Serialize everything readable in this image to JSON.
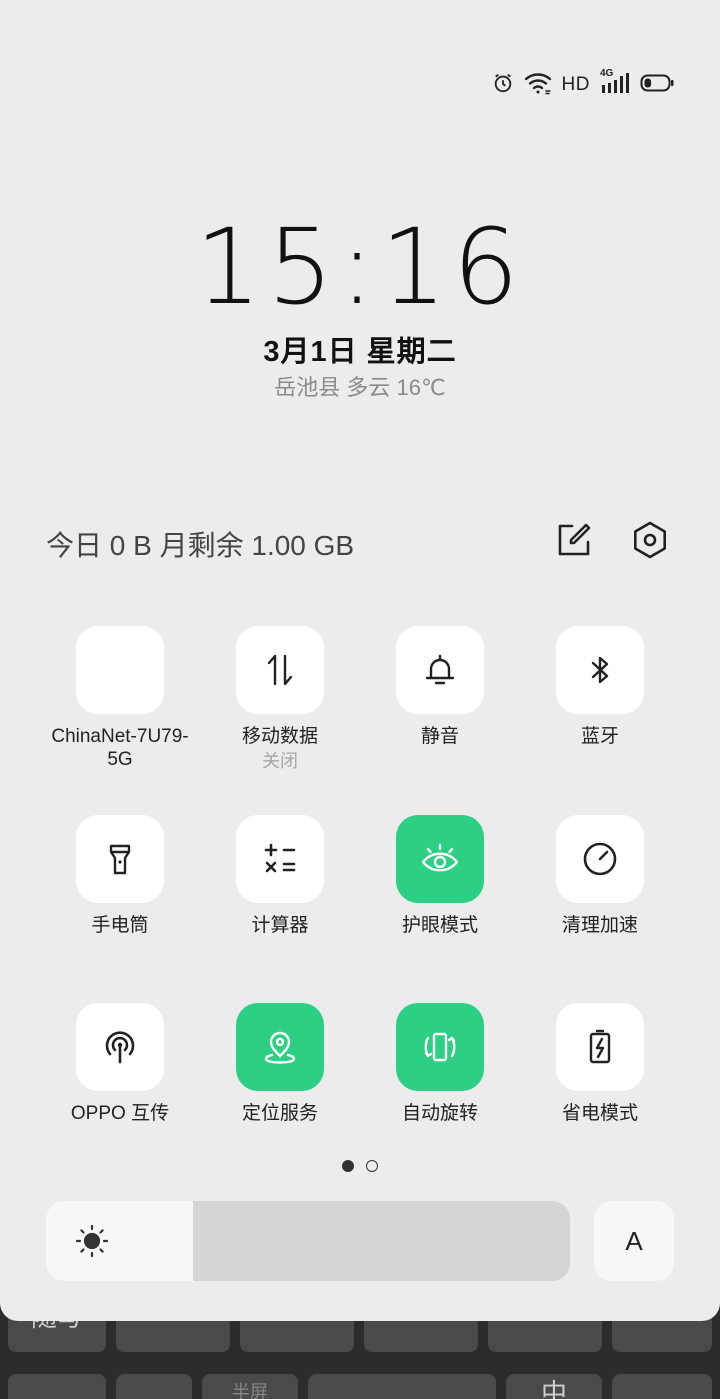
{
  "status": {
    "network_hd": "HD",
    "network_gen": "4G",
    "battery_level": 0.3
  },
  "lockscreen": {
    "time": "15:16",
    "date": "3月1日  星期二",
    "weather": "岳池县 多云 16℃"
  },
  "header": {
    "data_usage": "今日 0 B  月剩余 1.00 GB"
  },
  "tiles": [
    {
      "name": "wifi",
      "label": "ChinaNet-7U79-5G",
      "sub": "",
      "on": true
    },
    {
      "name": "mobile-data",
      "label": "移动数据",
      "sub": "关闭",
      "on": false
    },
    {
      "name": "silent",
      "label": "静音",
      "sub": "",
      "on": false
    },
    {
      "name": "bluetooth",
      "label": "蓝牙",
      "sub": "",
      "on": false
    },
    {
      "name": "flashlight",
      "label": "手电筒",
      "sub": "",
      "on": false
    },
    {
      "name": "calculator",
      "label": "计算器",
      "sub": "",
      "on": false
    },
    {
      "name": "eye-care",
      "label": "护眼模式",
      "sub": "",
      "on": true
    },
    {
      "name": "cleanup",
      "label": "清理加速",
      "sub": "",
      "on": false
    },
    {
      "name": "oppo-share",
      "label": "OPPO 互传",
      "sub": "",
      "on": false
    },
    {
      "name": "location",
      "label": "定位服务",
      "sub": "",
      "on": true
    },
    {
      "name": "auto-rotate",
      "label": "自动旋转",
      "sub": "",
      "on": true
    },
    {
      "name": "power-saving",
      "label": "省电模式",
      "sub": "",
      "on": false
    }
  ],
  "pager": {
    "pages": 2,
    "current": 0
  },
  "brightness": {
    "level": 0.28,
    "auto_label": "A"
  },
  "keyboard": {
    "key_suixie": "随写",
    "key_banping": "半屏",
    "key_zhong": "中"
  },
  "colors": {
    "accent": "#2dcf82",
    "panel_bg": "#ececec",
    "tile_bg": "#ffffff"
  }
}
